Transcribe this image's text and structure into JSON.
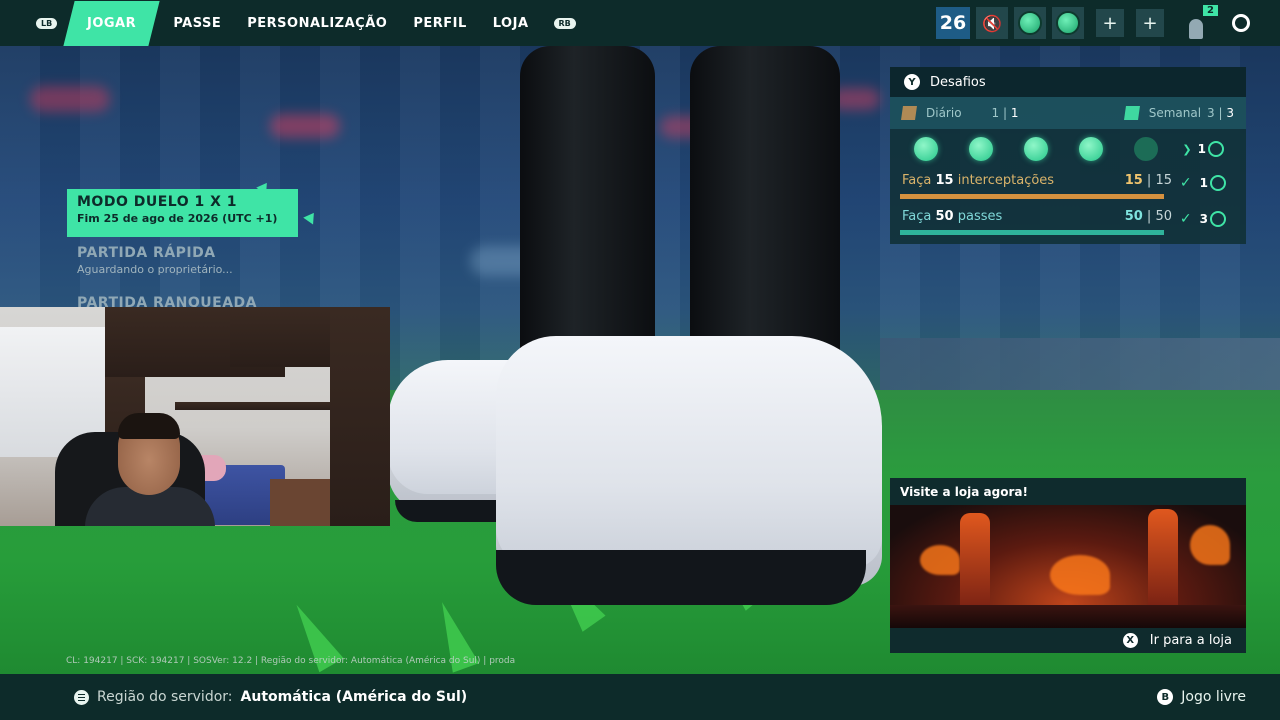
{
  "nav": {
    "lb_hint": "LB",
    "rb_hint": "RB",
    "tabs": [
      {
        "label": "JOGAR",
        "active": true
      },
      {
        "label": "PASSE",
        "active": false
      },
      {
        "label": "PERSONALIZAÇÃO",
        "active": false
      },
      {
        "label": "PERFIL",
        "active": false
      },
      {
        "label": "LOJA",
        "active": false
      }
    ],
    "level": "26",
    "friends_count": "2",
    "plus_label": "+"
  },
  "menu": {
    "selected": {
      "title": "MODO DUELO 1 X 1",
      "subtitle": "Fim 25 de ago de 2026 (UTC +1)"
    },
    "items": [
      {
        "title": "PARTIDA RÁPIDA",
        "subtitle": "Aguardando o proprietário..."
      },
      {
        "title": "PARTIDA RANQUEADA",
        "subtitle": ""
      }
    ]
  },
  "challenges": {
    "button": "Y",
    "title": "Desafios",
    "daily": {
      "label": "Diário",
      "done": "1",
      "total": "1"
    },
    "weekly": {
      "label": "Semanal",
      "done": "3",
      "total": "3"
    },
    "dots_filled": 4,
    "dots_total": 5,
    "dots_reward": "1",
    "tasks": [
      {
        "prefix": "Faça ",
        "amount": "15",
        "suffix": " interceptações",
        "current": "15",
        "target": "15",
        "reward": "1",
        "color": "orange",
        "progress": 1.0
      },
      {
        "prefix": "Faça ",
        "amount": "50",
        "suffix": " passes",
        "current": "50",
        "target": "50",
        "reward": "3",
        "color": "teal",
        "progress": 1.0
      }
    ]
  },
  "promo": {
    "title": "Visite a loja agora!",
    "button": "X",
    "action": "Ir para a loja"
  },
  "debug_line": "CL: 194217 | SCK: 194217 | SOSVer: 12.2 | Região do servidor: Automática (América do Sul) | proda",
  "footer": {
    "label": "Região do servidor:",
    "value": "Automática (América do Sul)",
    "right_button": "B",
    "right_label": "Jogo livre"
  },
  "colors": {
    "accent": "#3fe4a6",
    "bar_dark": "#0d2b2a",
    "task_orange": "#d5913f",
    "task_teal": "#2fb39b"
  }
}
